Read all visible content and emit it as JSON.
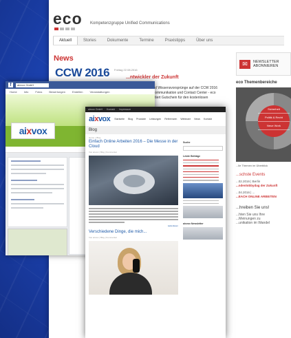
{
  "eco": {
    "logo": "eco",
    "tagline": "Kompetenzgruppe Unified Communications",
    "nav": [
      "Aktuell",
      "Stories",
      "Dokumente",
      "Termine",
      "Praxistipps",
      "Über uns"
    ],
    "news_heading": "News",
    "news_date": "Freitag 22.08.2016",
    "ccw_logo": "CCW 2016",
    "headline_suffix": "...ntwickler der Zukunft",
    "body_lines": [
      "...d Wissensvorsprünge auf der CCW 2016",
      "...ommunikation und Contact Center - eco",
      "...tiert Gutschein für den kostenlosen"
    ],
    "newsletter_line1": "NEWSLETTER",
    "newsletter_line2": "ABONNIEREN",
    "themes_heading": "eco Themenbereiche",
    "wheel_labels": [
      "Sicherheit",
      "Politik & Recht",
      "Neue Work"
    ],
    "wheel_caption": "...lle Themen im Überblick",
    "events_heading": "...schste Events",
    "events": [
      {
        "date": "...02.2016 | Berlin",
        "title": "...ndenlobbydag der Zukunft"
      },
      {
        "date": "...04.2016 | ...",
        "title": "...EACH ONLINE ARBEITEN"
      }
    ],
    "bottom_heading": "...hreiben Sie uns!",
    "bottom_lines": [
      "...hten Sie uns Ihre",
      "...Meinungen zu",
      "...unikation im Wandel"
    ]
  },
  "fb": {
    "logo_glyph": "f",
    "search_text": "aixvox GmbH",
    "tabs": [
      "Home",
      "Info",
      "Fotos",
      "Bewertungen",
      "Erstellen",
      "Veranstaltungen"
    ]
  },
  "blog": {
    "topbar": [
      "aixvox GmbH",
      "Kontakt",
      "Impressum"
    ],
    "logo_prefix": "ai",
    "logo_x": "x",
    "logo_suffix": "vox",
    "menu": [
      "Startseite",
      "Blog",
      "Produkte",
      "Leistungen",
      "Referenzen",
      "Webinare",
      "News",
      "Kontakt"
    ],
    "page_title": "Blog",
    "breadcrumb": "Home » Blog",
    "post1_title": "Einfach Online Arbeiten 2016 – Die Messe in der Cloud",
    "post1_meta": "Von aixvox | Blog | Kommentar",
    "read_more": "weiterlesen",
    "post2_title": "Verschiedene Dinge, die mich...",
    "post2_meta": "Von aixvox | Blog | Kommentar",
    "side_search": "Suche",
    "side_latest": "Letzte Beiträge",
    "side_newsletter": "aixvox Newsletter"
  }
}
